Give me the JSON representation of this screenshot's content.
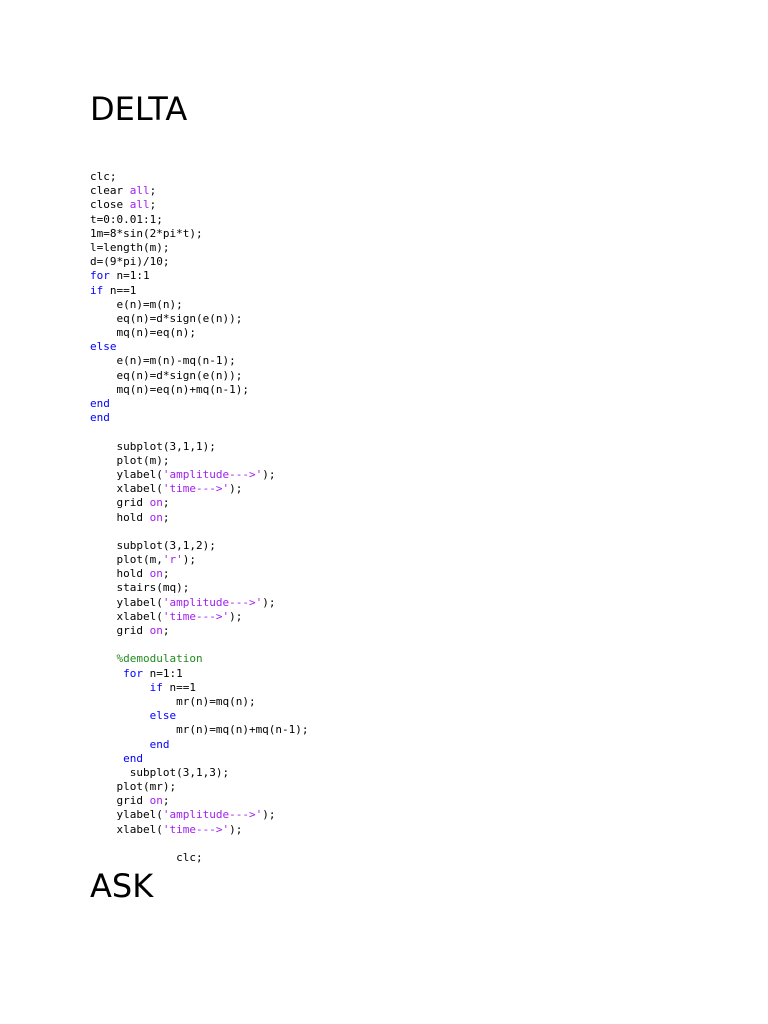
{
  "heading_delta": "DELTA",
  "heading_ask": "ASK",
  "colors": {
    "keyword": "#0000ff",
    "string": "#a020f0",
    "comment": "#228b22",
    "text": "#000000"
  },
  "code_lines": [
    [
      {
        "t": "clc;",
        "c": "plain"
      }
    ],
    [
      {
        "t": "clear ",
        "c": "plain"
      },
      {
        "t": "all",
        "c": "str"
      },
      {
        "t": ";",
        "c": "plain"
      }
    ],
    [
      {
        "t": "close ",
        "c": "plain"
      },
      {
        "t": "all",
        "c": "str"
      },
      {
        "t": ";",
        "c": "plain"
      }
    ],
    [
      {
        "t": "t=0:0.01:1;",
        "c": "plain"
      }
    ],
    [
      {
        "t": "1m=8*sin(2*pi*t);",
        "c": "plain"
      }
    ],
    [
      {
        "t": "l=length(m);",
        "c": "plain"
      }
    ],
    [
      {
        "t": "d=(9*pi)/10;",
        "c": "plain"
      }
    ],
    [
      {
        "t": "for",
        "c": "kw"
      },
      {
        "t": " n=1:1",
        "c": "plain"
      }
    ],
    [
      {
        "t": "if",
        "c": "kw"
      },
      {
        "t": " n==1",
        "c": "plain"
      }
    ],
    [
      {
        "t": "    e(n)=m(n);",
        "c": "plain"
      }
    ],
    [
      {
        "t": "    eq(n)=d*sign(e(n));",
        "c": "plain"
      }
    ],
    [
      {
        "t": "    mq(n)=eq(n);",
        "c": "plain"
      }
    ],
    [
      {
        "t": "else",
        "c": "kw"
      }
    ],
    [
      {
        "t": "    e(n)=m(n)-mq(n-1);",
        "c": "plain"
      }
    ],
    [
      {
        "t": "    eq(n)=d*sign(e(n));",
        "c": "plain"
      }
    ],
    [
      {
        "t": "    mq(n)=eq(n)+mq(n-1);",
        "c": "plain"
      }
    ],
    [
      {
        "t": "end",
        "c": "kw"
      }
    ],
    [
      {
        "t": "end",
        "c": "kw"
      }
    ],
    [
      {
        "t": "",
        "c": "plain"
      }
    ],
    [
      {
        "t": "    subplot(3,1,1);",
        "c": "plain"
      }
    ],
    [
      {
        "t": "    plot(m);",
        "c": "plain"
      }
    ],
    [
      {
        "t": "    ylabel(",
        "c": "plain"
      },
      {
        "t": "'amplitude--->'",
        "c": "str"
      },
      {
        "t": ");",
        "c": "plain"
      }
    ],
    [
      {
        "t": "    xlabel(",
        "c": "plain"
      },
      {
        "t": "'time--->'",
        "c": "str"
      },
      {
        "t": ");",
        "c": "plain"
      }
    ],
    [
      {
        "t": "    grid ",
        "c": "plain"
      },
      {
        "t": "on",
        "c": "str"
      },
      {
        "t": ";",
        "c": "plain"
      }
    ],
    [
      {
        "t": "    hold ",
        "c": "plain"
      },
      {
        "t": "on",
        "c": "str"
      },
      {
        "t": ";",
        "c": "plain"
      }
    ],
    [
      {
        "t": "",
        "c": "plain"
      }
    ],
    [
      {
        "t": "    subplot(3,1,2);",
        "c": "plain"
      }
    ],
    [
      {
        "t": "    plot(m,",
        "c": "plain"
      },
      {
        "t": "'r'",
        "c": "str"
      },
      {
        "t": ");",
        "c": "plain"
      }
    ],
    [
      {
        "t": "    hold ",
        "c": "plain"
      },
      {
        "t": "on",
        "c": "str"
      },
      {
        "t": ";",
        "c": "plain"
      }
    ],
    [
      {
        "t": "    stairs(mq);",
        "c": "plain"
      }
    ],
    [
      {
        "t": "    ylabel(",
        "c": "plain"
      },
      {
        "t": "'amplitude--->'",
        "c": "str"
      },
      {
        "t": ");",
        "c": "plain"
      }
    ],
    [
      {
        "t": "    xlabel(",
        "c": "plain"
      },
      {
        "t": "'time--->'",
        "c": "str"
      },
      {
        "t": ");",
        "c": "plain"
      }
    ],
    [
      {
        "t": "    grid ",
        "c": "plain"
      },
      {
        "t": "on",
        "c": "str"
      },
      {
        "t": ";",
        "c": "plain"
      }
    ],
    [
      {
        "t": "",
        "c": "plain"
      }
    ],
    [
      {
        "t": "    %demodulation",
        "c": "com"
      }
    ],
    [
      {
        "t": "     ",
        "c": "plain"
      },
      {
        "t": "for",
        "c": "kw"
      },
      {
        "t": " n=1:1",
        "c": "plain"
      }
    ],
    [
      {
        "t": "         ",
        "c": "plain"
      },
      {
        "t": "if",
        "c": "kw"
      },
      {
        "t": " n==1",
        "c": "plain"
      }
    ],
    [
      {
        "t": "             mr(n)=mq(n);",
        "c": "plain"
      }
    ],
    [
      {
        "t": "         ",
        "c": "plain"
      },
      {
        "t": "else",
        "c": "kw"
      }
    ],
    [
      {
        "t": "             mr(n)=mq(n)+mq(n-1);",
        "c": "plain"
      }
    ],
    [
      {
        "t": "         ",
        "c": "plain"
      },
      {
        "t": "end",
        "c": "kw"
      }
    ],
    [
      {
        "t": "     ",
        "c": "plain"
      },
      {
        "t": "end",
        "c": "kw"
      }
    ],
    [
      {
        "t": "      subplot(3,1,3);",
        "c": "plain"
      }
    ],
    [
      {
        "t": "    plot(mr);",
        "c": "plain"
      }
    ],
    [
      {
        "t": "    grid ",
        "c": "plain"
      },
      {
        "t": "on",
        "c": "str"
      },
      {
        "t": ";",
        "c": "plain"
      }
    ],
    [
      {
        "t": "    ylabel(",
        "c": "plain"
      },
      {
        "t": "'amplitude--->'",
        "c": "str"
      },
      {
        "t": ");",
        "c": "plain"
      }
    ],
    [
      {
        "t": "    xlabel(",
        "c": "plain"
      },
      {
        "t": "'time--->'",
        "c": "str"
      },
      {
        "t": ");",
        "c": "plain"
      }
    ],
    [
      {
        "t": "",
        "c": "plain"
      }
    ],
    [
      {
        "t": "             clc;",
        "c": "plain"
      }
    ]
  ]
}
